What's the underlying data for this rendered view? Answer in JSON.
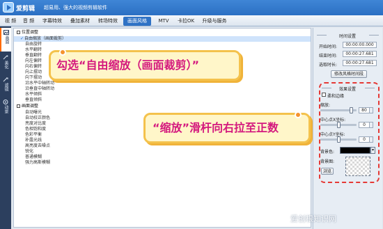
{
  "app": {
    "name": "爱剪辑",
    "slogan": "超易用、强大的视频剪辑软件"
  },
  "tabs": [
    {
      "label": "视 频"
    },
    {
      "label": "音 频"
    },
    {
      "label": "字幕特效"
    },
    {
      "label": "叠加素材"
    },
    {
      "label": "转场特效"
    },
    {
      "label": "画面风格",
      "active": true
    },
    {
      "label": "MTV"
    },
    {
      "label": "卡拉OK"
    },
    {
      "label": "升级与服务"
    }
  ],
  "sidebar": [
    {
      "label": "画面",
      "icon": "picture-icon",
      "active": true
    },
    {
      "label": "美化",
      "icon": "wand-icon"
    },
    {
      "label": "滤镜",
      "icon": "filter-icon"
    },
    {
      "label": "动景",
      "icon": "motion-icon"
    }
  ],
  "list": {
    "categories": [
      {
        "label": "位置调整",
        "items": [
          {
            "label": "自由缩放（画面裁剪）",
            "selected": true
          },
          {
            "label": "自由旋转"
          },
          {
            "label": "水平翻转"
          },
          {
            "label": "垂直翻转"
          },
          {
            "label": "向左偏转"
          },
          {
            "label": "向右偏转"
          },
          {
            "label": "向上摆动"
          },
          {
            "label": "向下摆动"
          },
          {
            "label": "沿水平中轴转动"
          },
          {
            "label": "沿垂直中轴转动"
          },
          {
            "label": "水平倾斜"
          },
          {
            "label": "垂直倾斜"
          }
        ]
      },
      {
        "label": "画面调整",
        "items": [
          {
            "label": "自动曝光"
          },
          {
            "label": "自动校正颜色"
          },
          {
            "label": "亮度对比度"
          },
          {
            "label": "色相饱和度"
          },
          {
            "label": "色彩平衡"
          },
          {
            "label": "补露光线"
          },
          {
            "label": "高亮度去噪点"
          },
          {
            "label": "锐化"
          },
          {
            "label": "普通模糊"
          },
          {
            "label": "强力高斯模糊"
          }
        ]
      }
    ]
  },
  "callouts": {
    "first": "勾选“自由缩放（画面裁剪）”",
    "second": "“缩放”滑杆向右拉至正数"
  },
  "time_settings": {
    "title": "时间设置",
    "start_label": "开始时间:",
    "start_value": "00:00:00.000",
    "end_label": "结束时间:",
    "end_value": "00:00:27.681",
    "duration_label": "选取时长:",
    "duration_value": "00:00:27.681",
    "button": "修改风格时间段"
  },
  "effects": {
    "title": "效果设置",
    "fade_label": "柔和边缘",
    "zoom_label": "缩放:",
    "zoom_value": "80",
    "zoom_fraction": 0.9,
    "cx_label": "中心点X坐标:",
    "cx_value": "0",
    "cx_fraction": 0.5,
    "cy_label": "中心点Y坐标:",
    "cy_value": "0",
    "cy_fraction": 0.5,
    "bgcolor_label": "背景色:",
    "bgimage_label": "背景图:",
    "browse_button": "浏览"
  },
  "watermark": "爱创根知识网",
  "colors": {
    "accent": "#2f72c5",
    "callout_text": "#d4197e",
    "callout_border": "#f4c24c",
    "highlight": "#e53935"
  }
}
